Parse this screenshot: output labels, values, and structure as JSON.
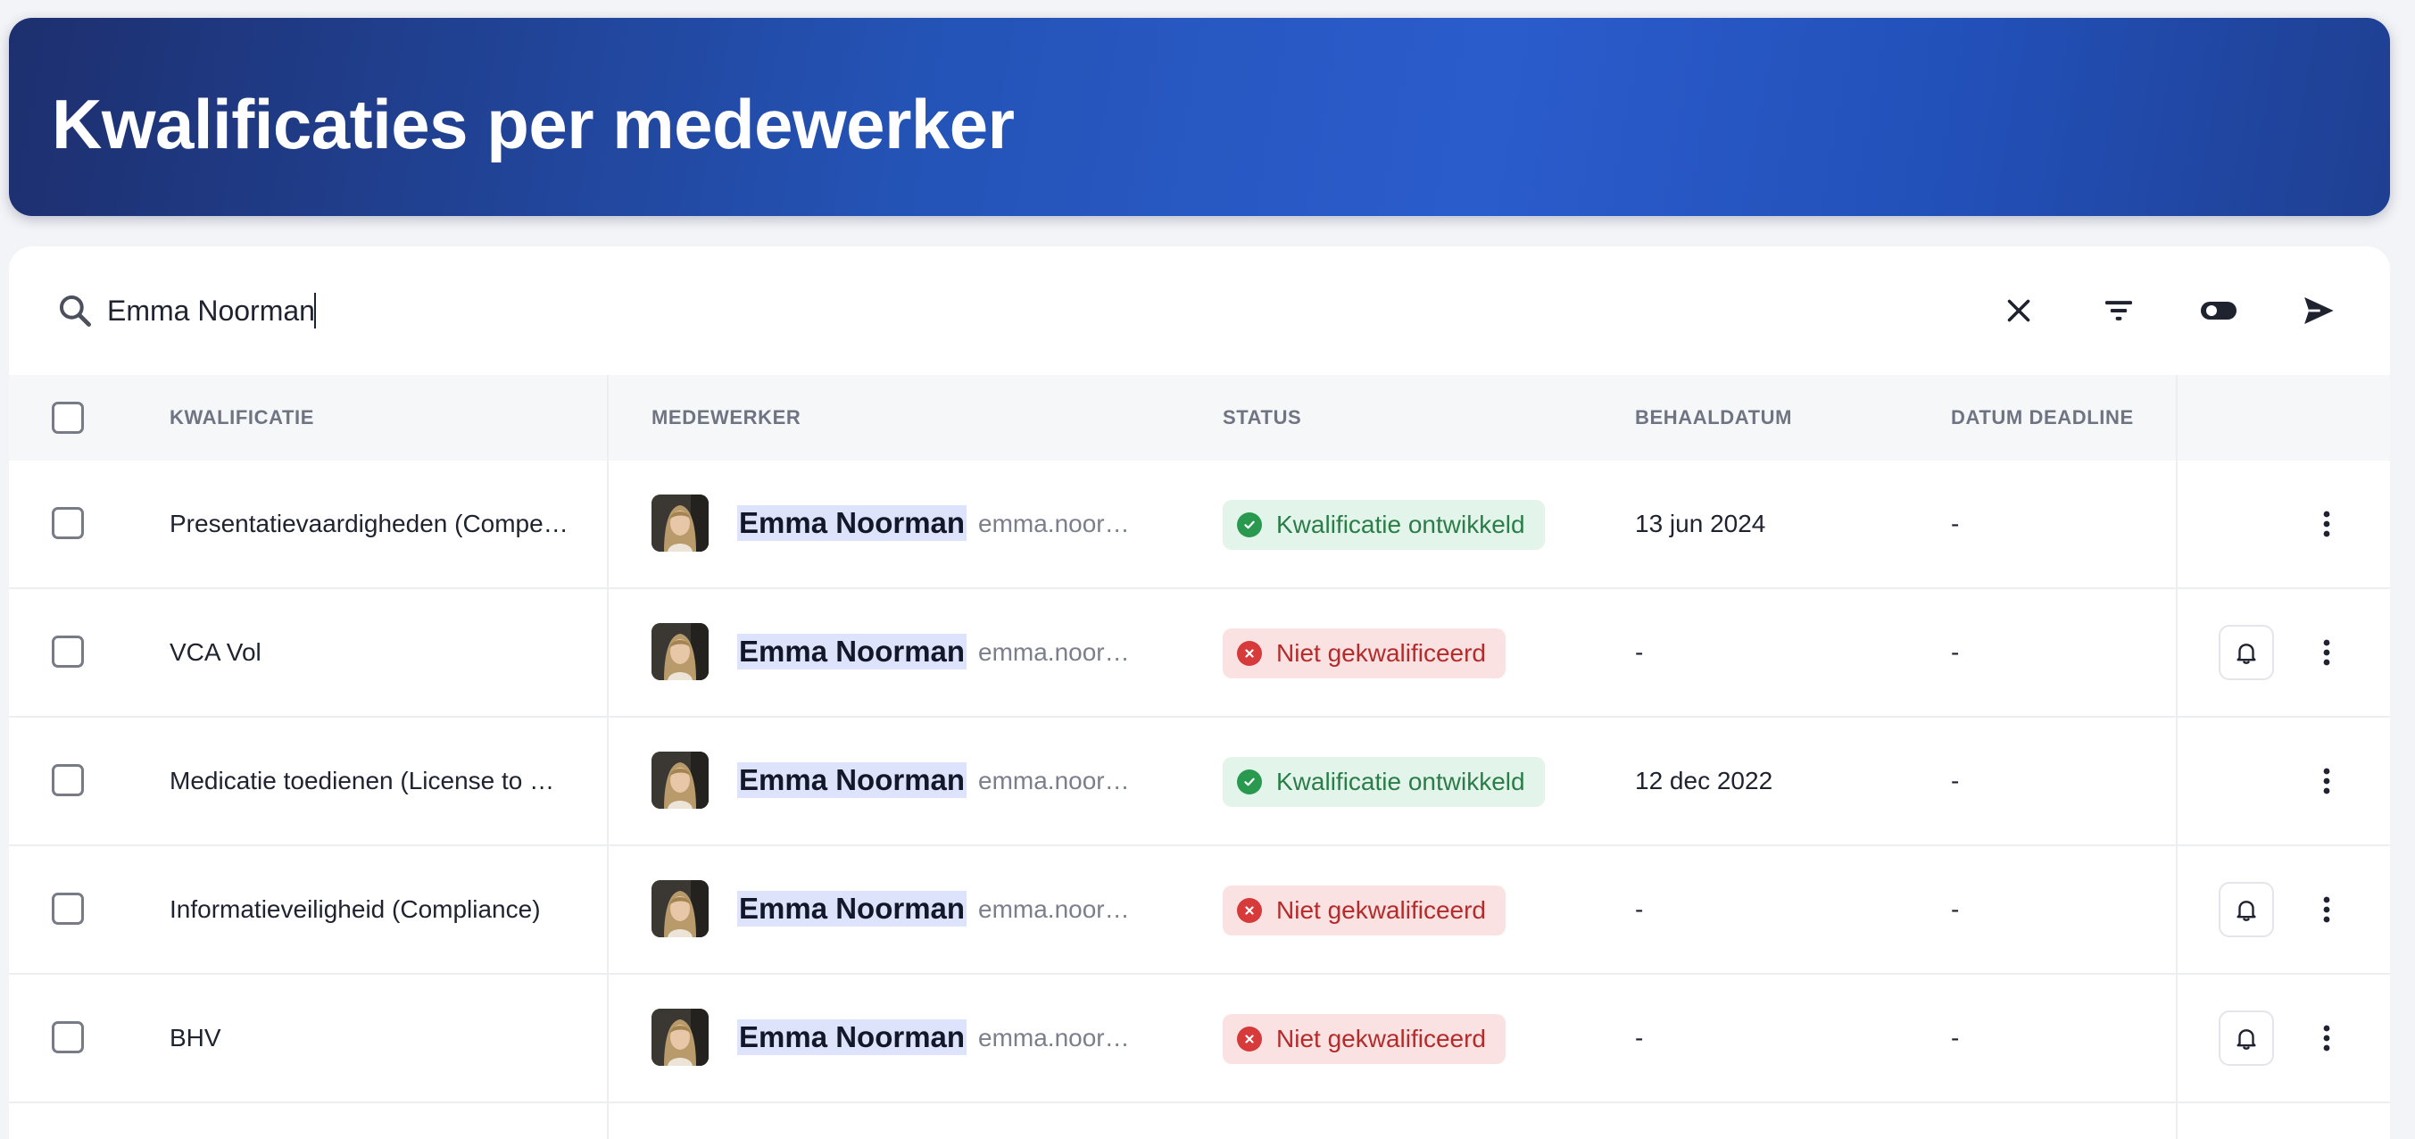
{
  "header": {
    "title": "Kwalificaties per medewerker"
  },
  "search": {
    "value": "Emma Noorman",
    "placeholder": ""
  },
  "toolbar": {
    "icons": [
      "clear-icon",
      "filter-icon",
      "toggle-icon",
      "send-icon"
    ]
  },
  "table": {
    "columns": [
      "KWALIFICATIE",
      "MEDEWERKER",
      "STATUS",
      "BEHAALDATUM",
      "DATUM DEADLINE"
    ],
    "rows": [
      {
        "qualification": "Presentatievaardigheden (Compe…",
        "employee": "Emma Noorman",
        "email": "emma.noor…",
        "status": "Kwalificatie ontwikkeld",
        "status_type": "ok",
        "achieved": "13 jun 2024",
        "deadline": "-",
        "bell": false
      },
      {
        "qualification": "VCA Vol",
        "employee": "Emma Noorman",
        "email": "emma.noor…",
        "status": "Niet gekwalificeerd",
        "status_type": "no",
        "achieved": "-",
        "deadline": "-",
        "bell": true
      },
      {
        "qualification": "Medicatie toedienen (License to …",
        "employee": "Emma Noorman",
        "email": "emma.noor…",
        "status": "Kwalificatie ontwikkeld",
        "status_type": "ok",
        "achieved": "12 dec 2022",
        "deadline": "-",
        "bell": false
      },
      {
        "qualification": "Informatieveiligheid (Compliance)",
        "employee": "Emma Noorman",
        "email": "emma.noor…",
        "status": "Niet gekwalificeerd",
        "status_type": "no",
        "achieved": "-",
        "deadline": "-",
        "bell": true
      },
      {
        "qualification": "BHV",
        "employee": "Emma Noorman",
        "email": "emma.noor…",
        "status": "Niet gekwalificeerd",
        "status_type": "no",
        "achieved": "-",
        "deadline": "-",
        "bell": true
      }
    ]
  },
  "colors": {
    "header_start": "#1d2f6e",
    "header_mid": "#2b5ccc",
    "ok_badge": "#e3f5ea",
    "no_badge": "#fbe2e2",
    "name_highlight": "#dde3fb"
  }
}
